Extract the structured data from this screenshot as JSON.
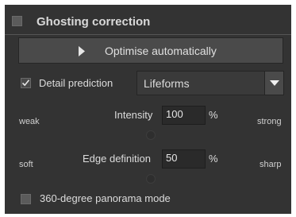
{
  "panel": {
    "title": "Ghosting correction",
    "title_checked": false,
    "optimise_label": "Optimise automatically",
    "detail": {
      "label": "Detail prediction",
      "checked": true,
      "selected_option": "Lifeforms"
    },
    "intensity": {
      "left": "weak",
      "label": "Intensity",
      "value": "100",
      "unit": "%",
      "right": "strong"
    },
    "edge": {
      "left": "soft",
      "label": "Edge definition",
      "value": "50",
      "unit": "%",
      "right": "sharp"
    },
    "panorama": {
      "label": "360-degree panorama mode",
      "checked": false
    }
  },
  "colors": {
    "panel_bg": "#333333",
    "text": "#dcdcdc",
    "input_bg": "#2a2a2a"
  }
}
